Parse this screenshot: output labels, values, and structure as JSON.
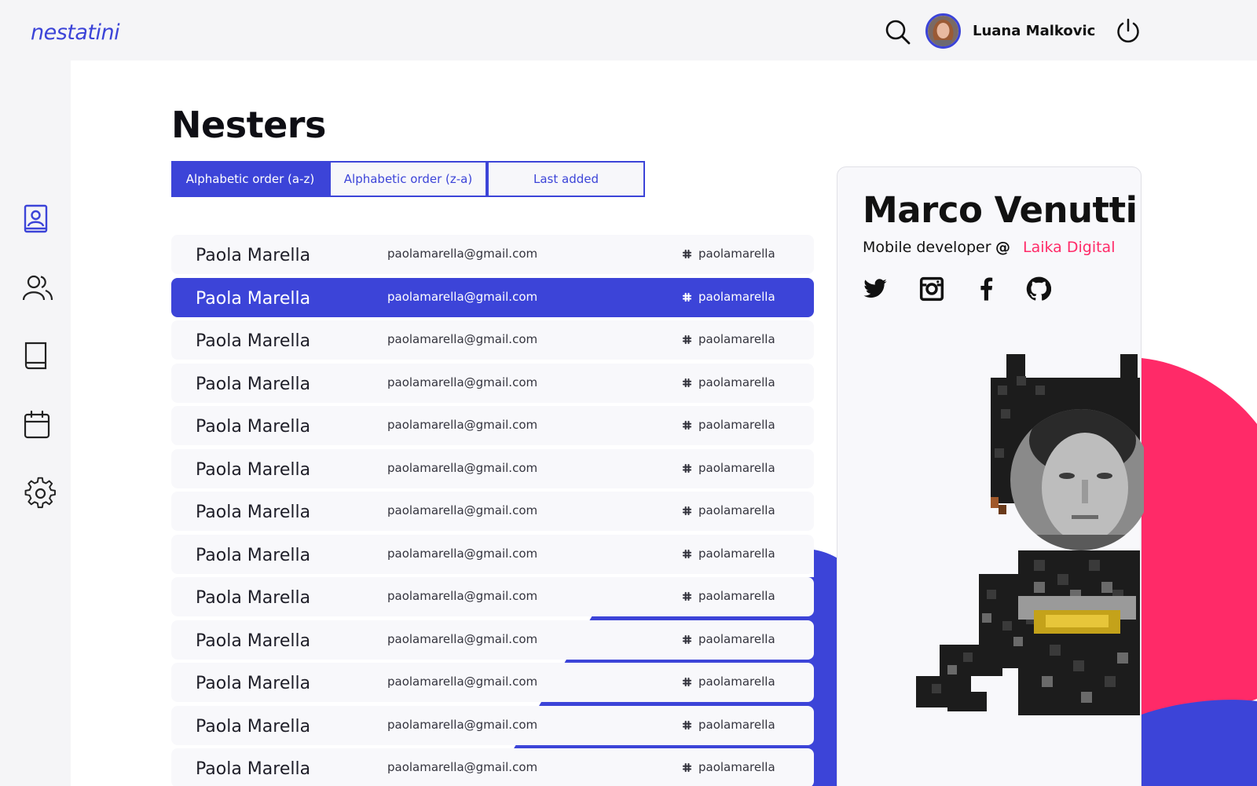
{
  "app": {
    "logo": "nestatini"
  },
  "header": {
    "user_name": "Luana Malkovic"
  },
  "page": {
    "title": "Nesters"
  },
  "tabs": [
    {
      "label": "Alphabetic order (a-z)",
      "active": true
    },
    {
      "label": "Alphabetic order (z-a)",
      "active": false
    },
    {
      "label": "Last added",
      "active": false
    }
  ],
  "nesters": [
    {
      "name": "Paola Marella",
      "email": "paolamarella@gmail.com",
      "handle": "paolamarella",
      "selected": false
    },
    {
      "name": "Paola Marella",
      "email": "paolamarella@gmail.com",
      "handle": "paolamarella",
      "selected": true
    },
    {
      "name": "Paola Marella",
      "email": "paolamarella@gmail.com",
      "handle": "paolamarella",
      "selected": false
    },
    {
      "name": "Paola Marella",
      "email": "paolamarella@gmail.com",
      "handle": "paolamarella",
      "selected": false
    },
    {
      "name": "Paola Marella",
      "email": "paolamarella@gmail.com",
      "handle": "paolamarella",
      "selected": false
    },
    {
      "name": "Paola Marella",
      "email": "paolamarella@gmail.com",
      "handle": "paolamarella",
      "selected": false
    },
    {
      "name": "Paola Marella",
      "email": "paolamarella@gmail.com",
      "handle": "paolamarella",
      "selected": false
    },
    {
      "name": "Paola Marella",
      "email": "paolamarella@gmail.com",
      "handle": "paolamarella",
      "selected": false
    },
    {
      "name": "Paola Marella",
      "email": "paolamarella@gmail.com",
      "handle": "paolamarella",
      "selected": false
    },
    {
      "name": "Paola Marella",
      "email": "paolamarella@gmail.com",
      "handle": "paolamarella",
      "selected": false
    },
    {
      "name": "Paola Marella",
      "email": "paolamarella@gmail.com",
      "handle": "paolamarella",
      "selected": false
    },
    {
      "name": "Paola Marella",
      "email": "paolamarella@gmail.com",
      "handle": "paolamarella",
      "selected": false
    },
    {
      "name": "Paola Marella",
      "email": "paolamarella@gmail.com",
      "handle": "paolamarella",
      "selected": false
    }
  ],
  "profile": {
    "name": "Marco Venutti",
    "role": "Mobile developer",
    "at": "@",
    "company": "Laika Digital",
    "social": [
      "twitter-icon",
      "instagram-icon",
      "facebook-icon",
      "github-icon"
    ]
  },
  "sidebar": {
    "items": [
      "contacts-icon",
      "users-icon",
      "book-icon",
      "calendar-icon",
      "settings-icon"
    ]
  },
  "colors": {
    "accent": "#3c44d8",
    "brand_pink": "#ff2a68",
    "background": "#f5f5f7"
  }
}
